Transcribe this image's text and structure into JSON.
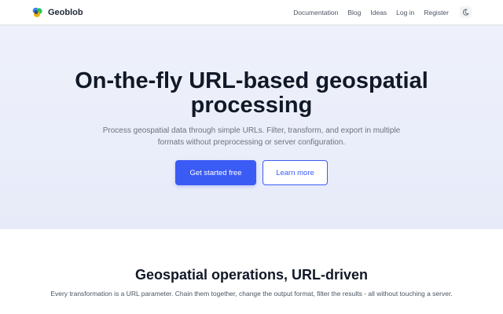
{
  "brand": {
    "name": "Geoblob",
    "icon": "geoblob-logo"
  },
  "nav": {
    "items": [
      "Documentation",
      "Blog",
      "Ideas",
      "Log in",
      "Register"
    ],
    "theme_toggle_icon": "moon-icon"
  },
  "hero": {
    "title": "On-the-fly URL-based geospatial processing",
    "subtitle": "Process geospatial data through simple URLs. Filter, transform, and export in multiple formats without preprocessing or server configuration.",
    "primary_button": "Get started free",
    "secondary_button": "Learn more"
  },
  "features": {
    "title": "Geospatial operations, URL-driven",
    "description": "Every transformation is a URL parameter. Chain them together, change the output format, filter the results - all without touching a server."
  },
  "colors": {
    "accent": "#3b5bf5",
    "hero_bg": "#eef1fb",
    "text_dark": "#111827",
    "text_muted": "#6b7280"
  }
}
